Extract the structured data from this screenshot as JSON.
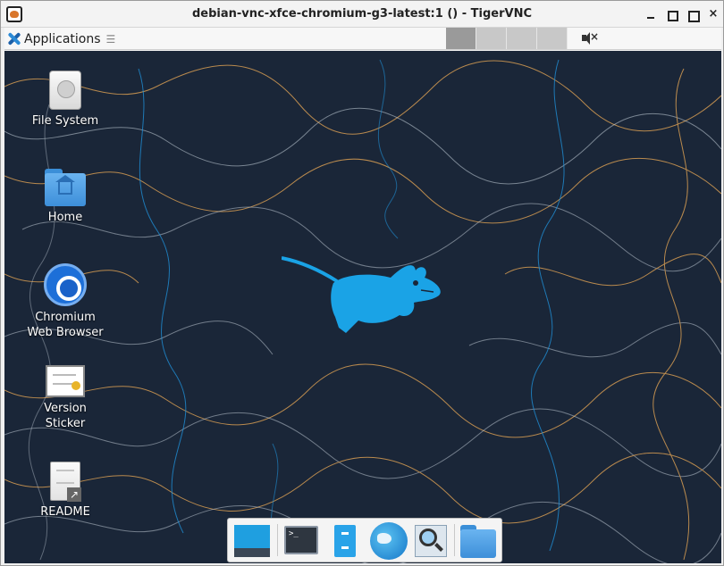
{
  "window": {
    "title": "debian-vnc-xfce-chromium-g3-latest:1 () - TigerVNC",
    "close_symbol": "×"
  },
  "panel": {
    "applications_label": "Applications",
    "menu_separator": "☰",
    "workspaces": [
      "1",
      "2",
      "3",
      "4"
    ],
    "volume_icon": "volume-muted-icon"
  },
  "desktop_icons": [
    {
      "name": "file-system",
      "label": "File System",
      "icon": "drive-harddisk-icon"
    },
    {
      "name": "home",
      "label": "Home",
      "icon": "home-folder-icon"
    },
    {
      "name": "chromium",
      "label": "Chromium\nWeb Browser",
      "icon": "chromium-icon"
    },
    {
      "name": "version-sticker",
      "label": "Version\nSticker",
      "icon": "certificate-icon"
    },
    {
      "name": "readme",
      "label": "README",
      "icon": "text-document-link-icon"
    }
  ],
  "dock": {
    "items": [
      "show-desktop-icon",
      "terminal-icon",
      "file-manager-icon",
      "web-browser-icon",
      "app-finder-icon",
      "folder-icon"
    ],
    "terminal_prompt": ">_"
  },
  "colors": {
    "desktop_bg": "#1a2638",
    "mouse_logo": "#1aa3e6",
    "contour_orange": "#b98a4e",
    "contour_white": "#c9d3dd",
    "contour_blue": "#1f8fd6"
  }
}
